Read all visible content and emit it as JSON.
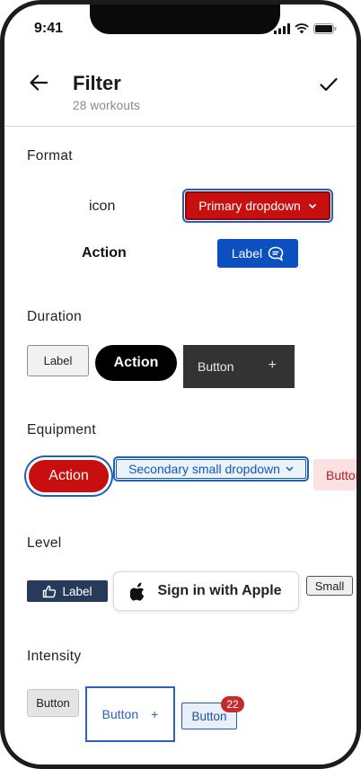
{
  "status_bar": {
    "time": "9:41"
  },
  "header": {
    "title": "Filter",
    "subtitle": "28 workouts"
  },
  "sections": {
    "format": {
      "title": "Format",
      "icon_text": "icon",
      "primary_dropdown_label": "Primary dropdown",
      "action_text": "Action",
      "label_button": "Label"
    },
    "duration": {
      "title": "Duration",
      "label_button": "Label",
      "action_button": "Action",
      "dark_button": "Button",
      "dark_button_plus": "+"
    },
    "equipment": {
      "title": "Equipment",
      "action_button": "Action",
      "secondary_dropdown_label": "Secondary small dropdown",
      "pink_button": "Button"
    },
    "level": {
      "title": "Level",
      "label_button": "Label",
      "apple_button": "Sign in with Apple",
      "small_button": "Small"
    },
    "intensity": {
      "title": "Intensity",
      "gray_button": "Button",
      "outline_button": "Button",
      "outline_button_plus": "+",
      "badge_button": "Button",
      "badge_count": "22"
    }
  },
  "colors": {
    "primary_red": "#c70f0f",
    "primary_blue": "#0b4fc0",
    "focus_blue": "#1f5fbf",
    "navy": "#263a5c"
  }
}
